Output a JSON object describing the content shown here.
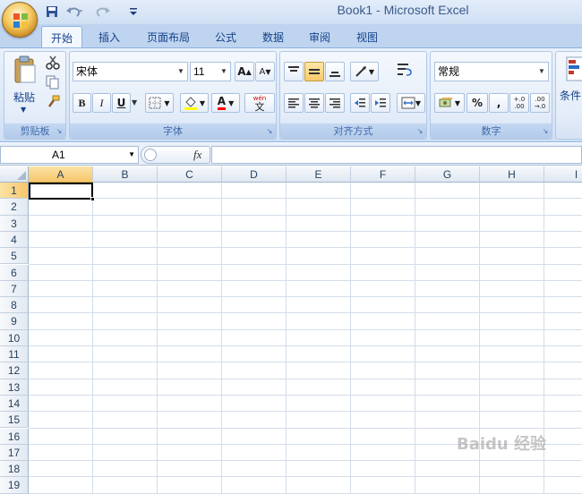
{
  "window": {
    "title": "Book1 - Microsoft Excel"
  },
  "quick_access": {
    "save_icon": "save-icon",
    "undo_icon": "undo-icon",
    "redo_icon": "redo-icon",
    "customize_icon": "qat-customize-icon"
  },
  "tabs": [
    {
      "label": "开始",
      "active": true
    },
    {
      "label": "插入"
    },
    {
      "label": "页面布局"
    },
    {
      "label": "公式"
    },
    {
      "label": "数据"
    },
    {
      "label": "审阅"
    },
    {
      "label": "视图"
    }
  ],
  "ribbon": {
    "clipboard": {
      "label": "剪贴板",
      "paste_label": "粘贴"
    },
    "font": {
      "label": "字体",
      "font_name": "宋体",
      "font_size": "11",
      "bold": "B",
      "italic": "I",
      "underline": "U",
      "font_color_letter": "A",
      "grow_font": "A",
      "shrink_font": "A",
      "phonetic": "wén",
      "phonetic_char": "文"
    },
    "alignment": {
      "label": "对齐方式"
    },
    "number": {
      "label": "数字",
      "format": "常规",
      "percent": "%",
      "comma": ",",
      "inc_decimal": "+.0 .00",
      "dec_decimal": ".00 →.0"
    },
    "styles": {
      "partial_label": "条件"
    }
  },
  "formula_bar": {
    "name_box": "A1",
    "fx_label": "fx",
    "value": ""
  },
  "sheet": {
    "columns": [
      "A",
      "B",
      "C",
      "D",
      "E",
      "F",
      "G",
      "H",
      "I"
    ],
    "rows": [
      "1",
      "2",
      "3",
      "4",
      "5",
      "6",
      "7",
      "8",
      "9",
      "10",
      "11",
      "12",
      "13",
      "14",
      "15",
      "16",
      "17",
      "18",
      "19"
    ],
    "active_cell": "A1"
  },
  "colors": {
    "ribbon_text": "#15428b",
    "grid_line": "#d4dde9",
    "selected_header": "#f6c66b"
  },
  "watermark": "Baidu 经验"
}
